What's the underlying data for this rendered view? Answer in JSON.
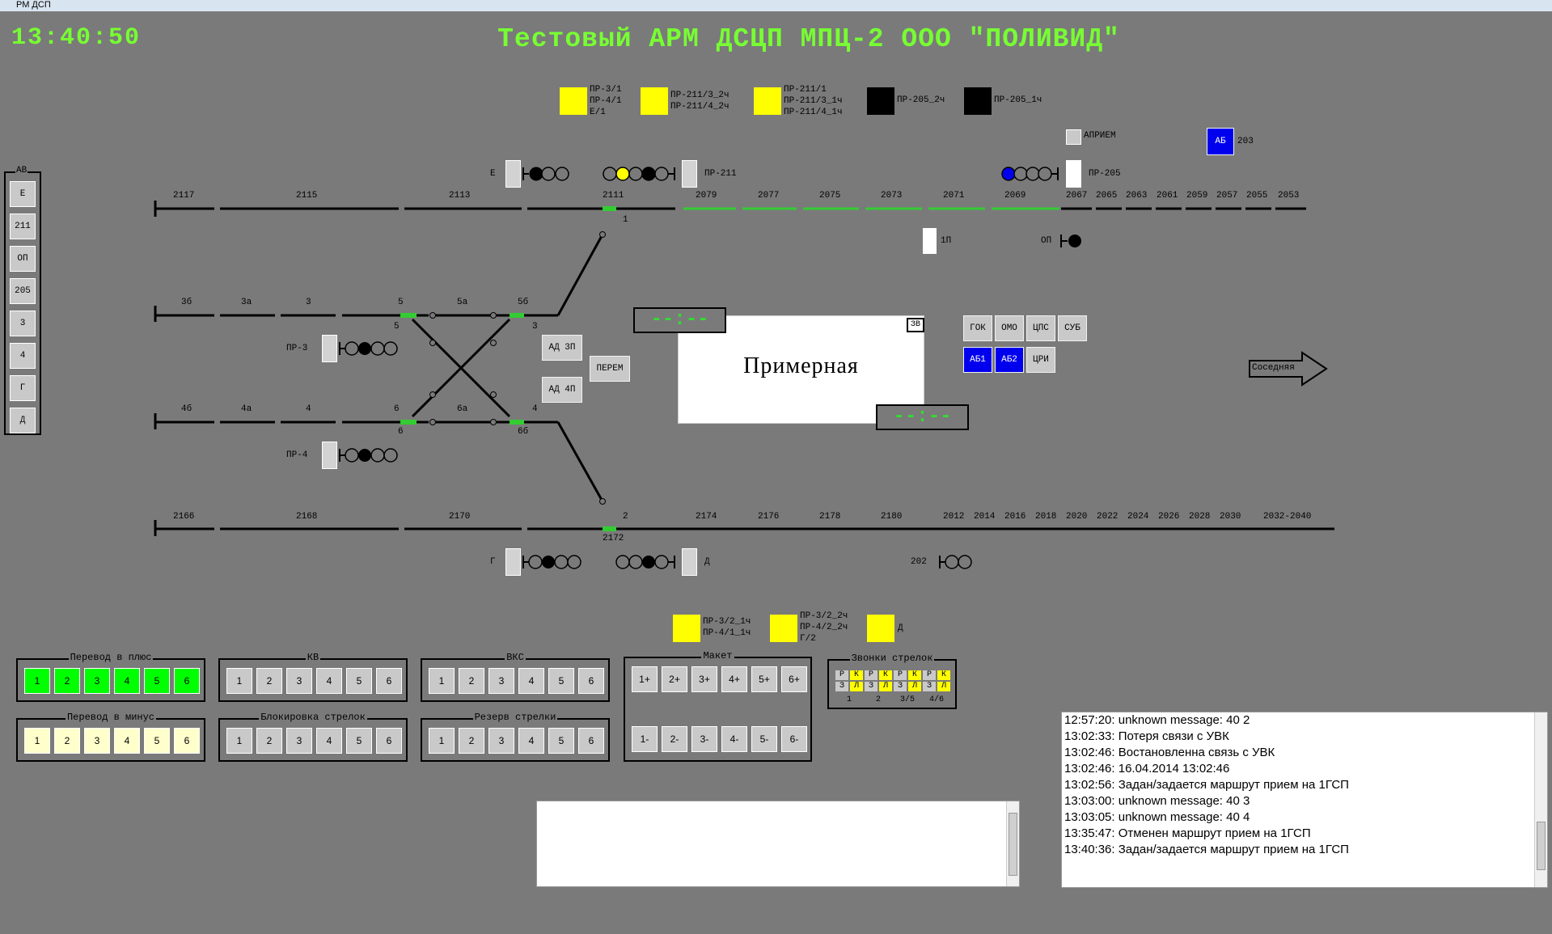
{
  "window": {
    "title": "РМ ДСП",
    "min": "–",
    "max": "□",
    "close": "✕"
  },
  "header": {
    "clock": "13:40:50",
    "title": "Тестовый АРМ ДСЦП МПЦ-2 ООО \"ПОЛИВИД\""
  },
  "top_indicators": [
    {
      "lines": [
        "ПР-3/1",
        "ПР-4/1",
        "Е/1"
      ],
      "color": "#ffff00"
    },
    {
      "lines": [
        "ПР-211/3_2ч",
        "ПР-211/4_2ч"
      ],
      "color": "#ffff00"
    },
    {
      "lines": [
        "ПР-211/1",
        "ПР-211/3_1ч",
        "ПР-211/4_1ч"
      ],
      "color": "#ffff00"
    },
    {
      "lines": [
        "ПР-205_2ч"
      ],
      "color": "#000000"
    },
    {
      "lines": [
        "ПР-205_1ч"
      ],
      "color": "#000000"
    }
  ],
  "bottom_indicators": [
    {
      "lines": [
        "ПР-3/2_1ч",
        "ПР-4/1_1ч"
      ],
      "color": "#ffff00"
    },
    {
      "lines": [
        "ПР-3/2_2ч",
        "ПР-4/2_2ч",
        "Г/2"
      ],
      "color": "#ffff00"
    },
    {
      "lines": [
        "Д"
      ],
      "color": "#ffff00"
    }
  ],
  "apriem": "АПРИЕМ",
  "ab_block": {
    "label": "АБ",
    "number": "203"
  },
  "av_panel": {
    "title": "АВ",
    "buttons": [
      "Е",
      "211",
      "ОП",
      "205",
      "3",
      "4",
      "Г",
      "Д"
    ]
  },
  "track_labels": {
    "top": [
      "2117",
      "2115",
      "2113",
      "2111",
      "2079",
      "2077",
      "2075",
      "2073",
      "2071",
      "2069",
      "2067",
      "2065",
      "2063",
      "2061",
      "2059",
      "2057",
      "2055",
      "2053"
    ],
    "t3": [
      "3б",
      "3а",
      "3",
      "5",
      "5а",
      "5б"
    ],
    "t4": [
      "4б",
      "4а",
      "4",
      "6",
      "6а",
      "4"
    ],
    "bottom": [
      "2166",
      "2168",
      "2170",
      "2",
      "2174",
      "2176",
      "2178",
      "2180",
      "2012",
      "2014",
      "2016",
      "2018",
      "2020",
      "2022",
      "2024",
      "2026",
      "2028",
      "2030",
      "2032-2040"
    ],
    "misc": [
      "1",
      "5",
      "3",
      "6",
      "6б",
      "2172"
    ]
  },
  "signals": {
    "E": "Е",
    "pr211": "ПР-211",
    "pr205": "ПР-205",
    "p1": "1П",
    "op": "ОП",
    "pr3": "ПР-3",
    "pr4": "ПР-4",
    "g": "Г",
    "d": "Д",
    "s202": "202"
  },
  "middle_buttons": {
    "ad3p": "АД 3П",
    "ad4p": "АД 4П",
    "perem": "ПЕРЕМ"
  },
  "station": {
    "name": "Примерная",
    "zv": "ЗВ",
    "time_top": "--:--",
    "time_bottom": "--:--"
  },
  "right_buttons": {
    "gok": "ГОК",
    "omo": "ОМО",
    "cps": "ЦПС",
    "sub": "СУБ",
    "ab1": "АБ1",
    "ab2": "АБ2",
    "cri": "ЦРИ"
  },
  "neighbor": "Соседняя",
  "groups": {
    "plus": {
      "title": "Перевод в плюс",
      "buttons": [
        "1",
        "2",
        "3",
        "4",
        "5",
        "6"
      ]
    },
    "minus": {
      "title": "Перевод в минус",
      "buttons": [
        "1",
        "2",
        "3",
        "4",
        "5",
        "6"
      ]
    },
    "kv": {
      "title": "КВ",
      "buttons": [
        "1",
        "2",
        "3",
        "4",
        "5",
        "6"
      ]
    },
    "block": {
      "title": "Блокировка стрелок",
      "buttons": [
        "1",
        "2",
        "3",
        "4",
        "5",
        "6"
      ]
    },
    "vks": {
      "title": "ВКС",
      "buttons": [
        "1",
        "2",
        "3",
        "4",
        "5",
        "6"
      ]
    },
    "reserve": {
      "title": "Резерв стрелки",
      "buttons": [
        "1",
        "2",
        "3",
        "4",
        "5",
        "6"
      ]
    },
    "maket": {
      "title": "Макет",
      "plus": [
        "1+",
        "2+",
        "3+",
        "4+",
        "5+",
        "6+"
      ],
      "minus": [
        "1-",
        "2-",
        "3-",
        "4-",
        "5-",
        "6-"
      ]
    },
    "bells": {
      "title": "Звонки стрелок",
      "top": [
        "Р",
        "К",
        "Р",
        "К",
        "Р",
        "К",
        "Р",
        "К"
      ],
      "bot": [
        "З",
        "Л",
        "З",
        "Л",
        "З",
        "Л",
        "З",
        "Л"
      ],
      "nums": [
        "1",
        "2",
        "3/5",
        "4/6"
      ]
    }
  },
  "log": [
    "12:57:20: unknown message: 40 2",
    "13:02:33: Потеря связи с УВК",
    "13:02:46: Востановленна связь с УВК",
    "13:02:46: 16.04.2014 13:02:46",
    "13:02:56: Задан/задается маршрут прием на 1ГСП",
    "13:03:00: unknown message: 40 3",
    "13:03:05: unknown message: 40 4",
    "13:35:47: Отменен маршрут прием на 1ГСП",
    "13:40:36: Задан/задается маршрут прием на 1ГСП"
  ],
  "colors": {
    "bg": "#7a7a7a",
    "green_text": "#77ff33",
    "track_green": "#33cc33",
    "yellow": "#ffff00",
    "blue": "#0000ee",
    "light_yellow": "#ffffcc",
    "bright_green": "#00ff00"
  }
}
